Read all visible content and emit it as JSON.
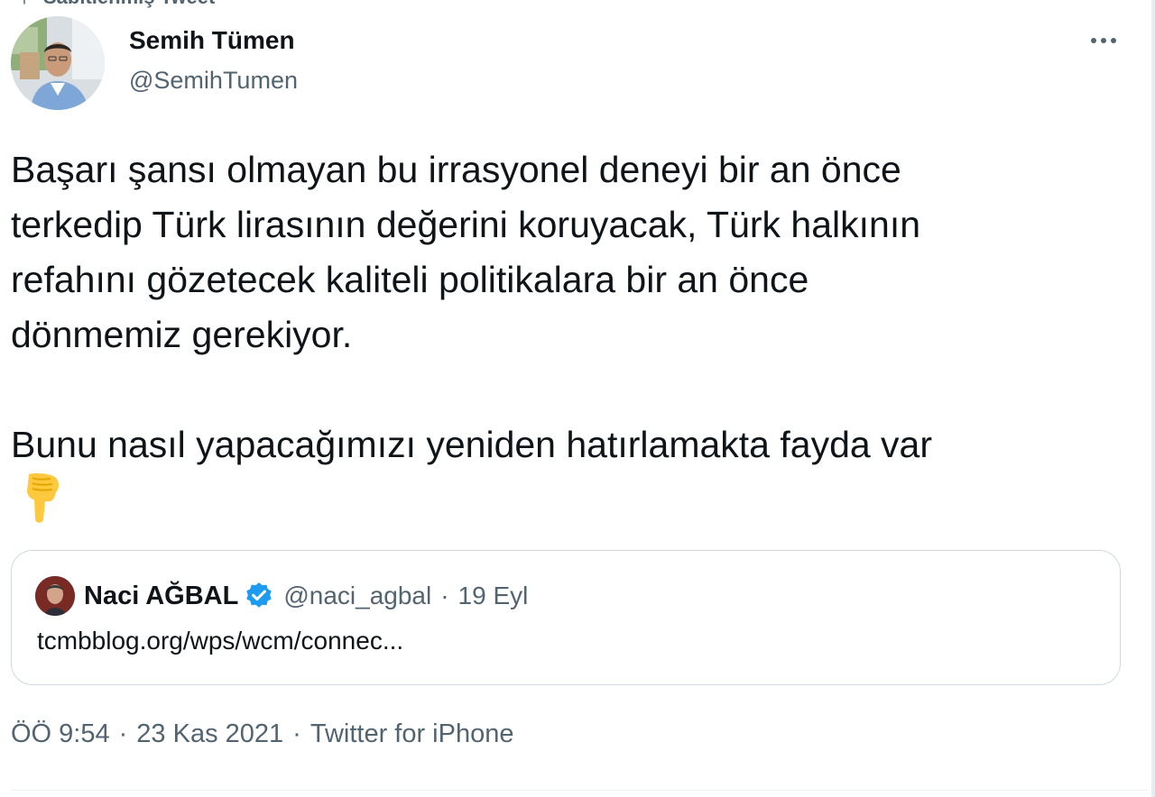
{
  "pinned": {
    "label": "Sabitlenmiş Tweet"
  },
  "author": {
    "name": "Semih Tümen",
    "handle": "@SemihTumen",
    "avatar_icon": "user-photo"
  },
  "tweet": {
    "paragraph_1": "Başarı şansı olmayan bu irrasyonel deneyi bir an önce\nterkedip Türk lirasının değerini koruyacak, Türk halkının\nrefahını gözetecek kaliteli politikalara bir an önce\ndönmemiz gerekiyor.",
    "paragraph_2": "Bunu nasıl yapacağımızı yeniden hatırlamakta fayda var",
    "emoji": "backhand-index-pointing-down"
  },
  "quote": {
    "name": "Naci AĞBAL",
    "handle": "@naci_agbal",
    "separator": "·",
    "date": "19 Eyl",
    "link_text": "tcmbblog.org/wps/wcm/connec...",
    "verified_icon": "verified-badge",
    "verified_color": "#1d9bf0"
  },
  "meta": {
    "time": "ÖÖ 9:54",
    "separator": "·",
    "date": "23 Kas 2021",
    "source": "Twitter for iPhone"
  },
  "colors": {
    "text": "#0f1419",
    "secondary": "#536471",
    "border": "#cfd9de"
  }
}
